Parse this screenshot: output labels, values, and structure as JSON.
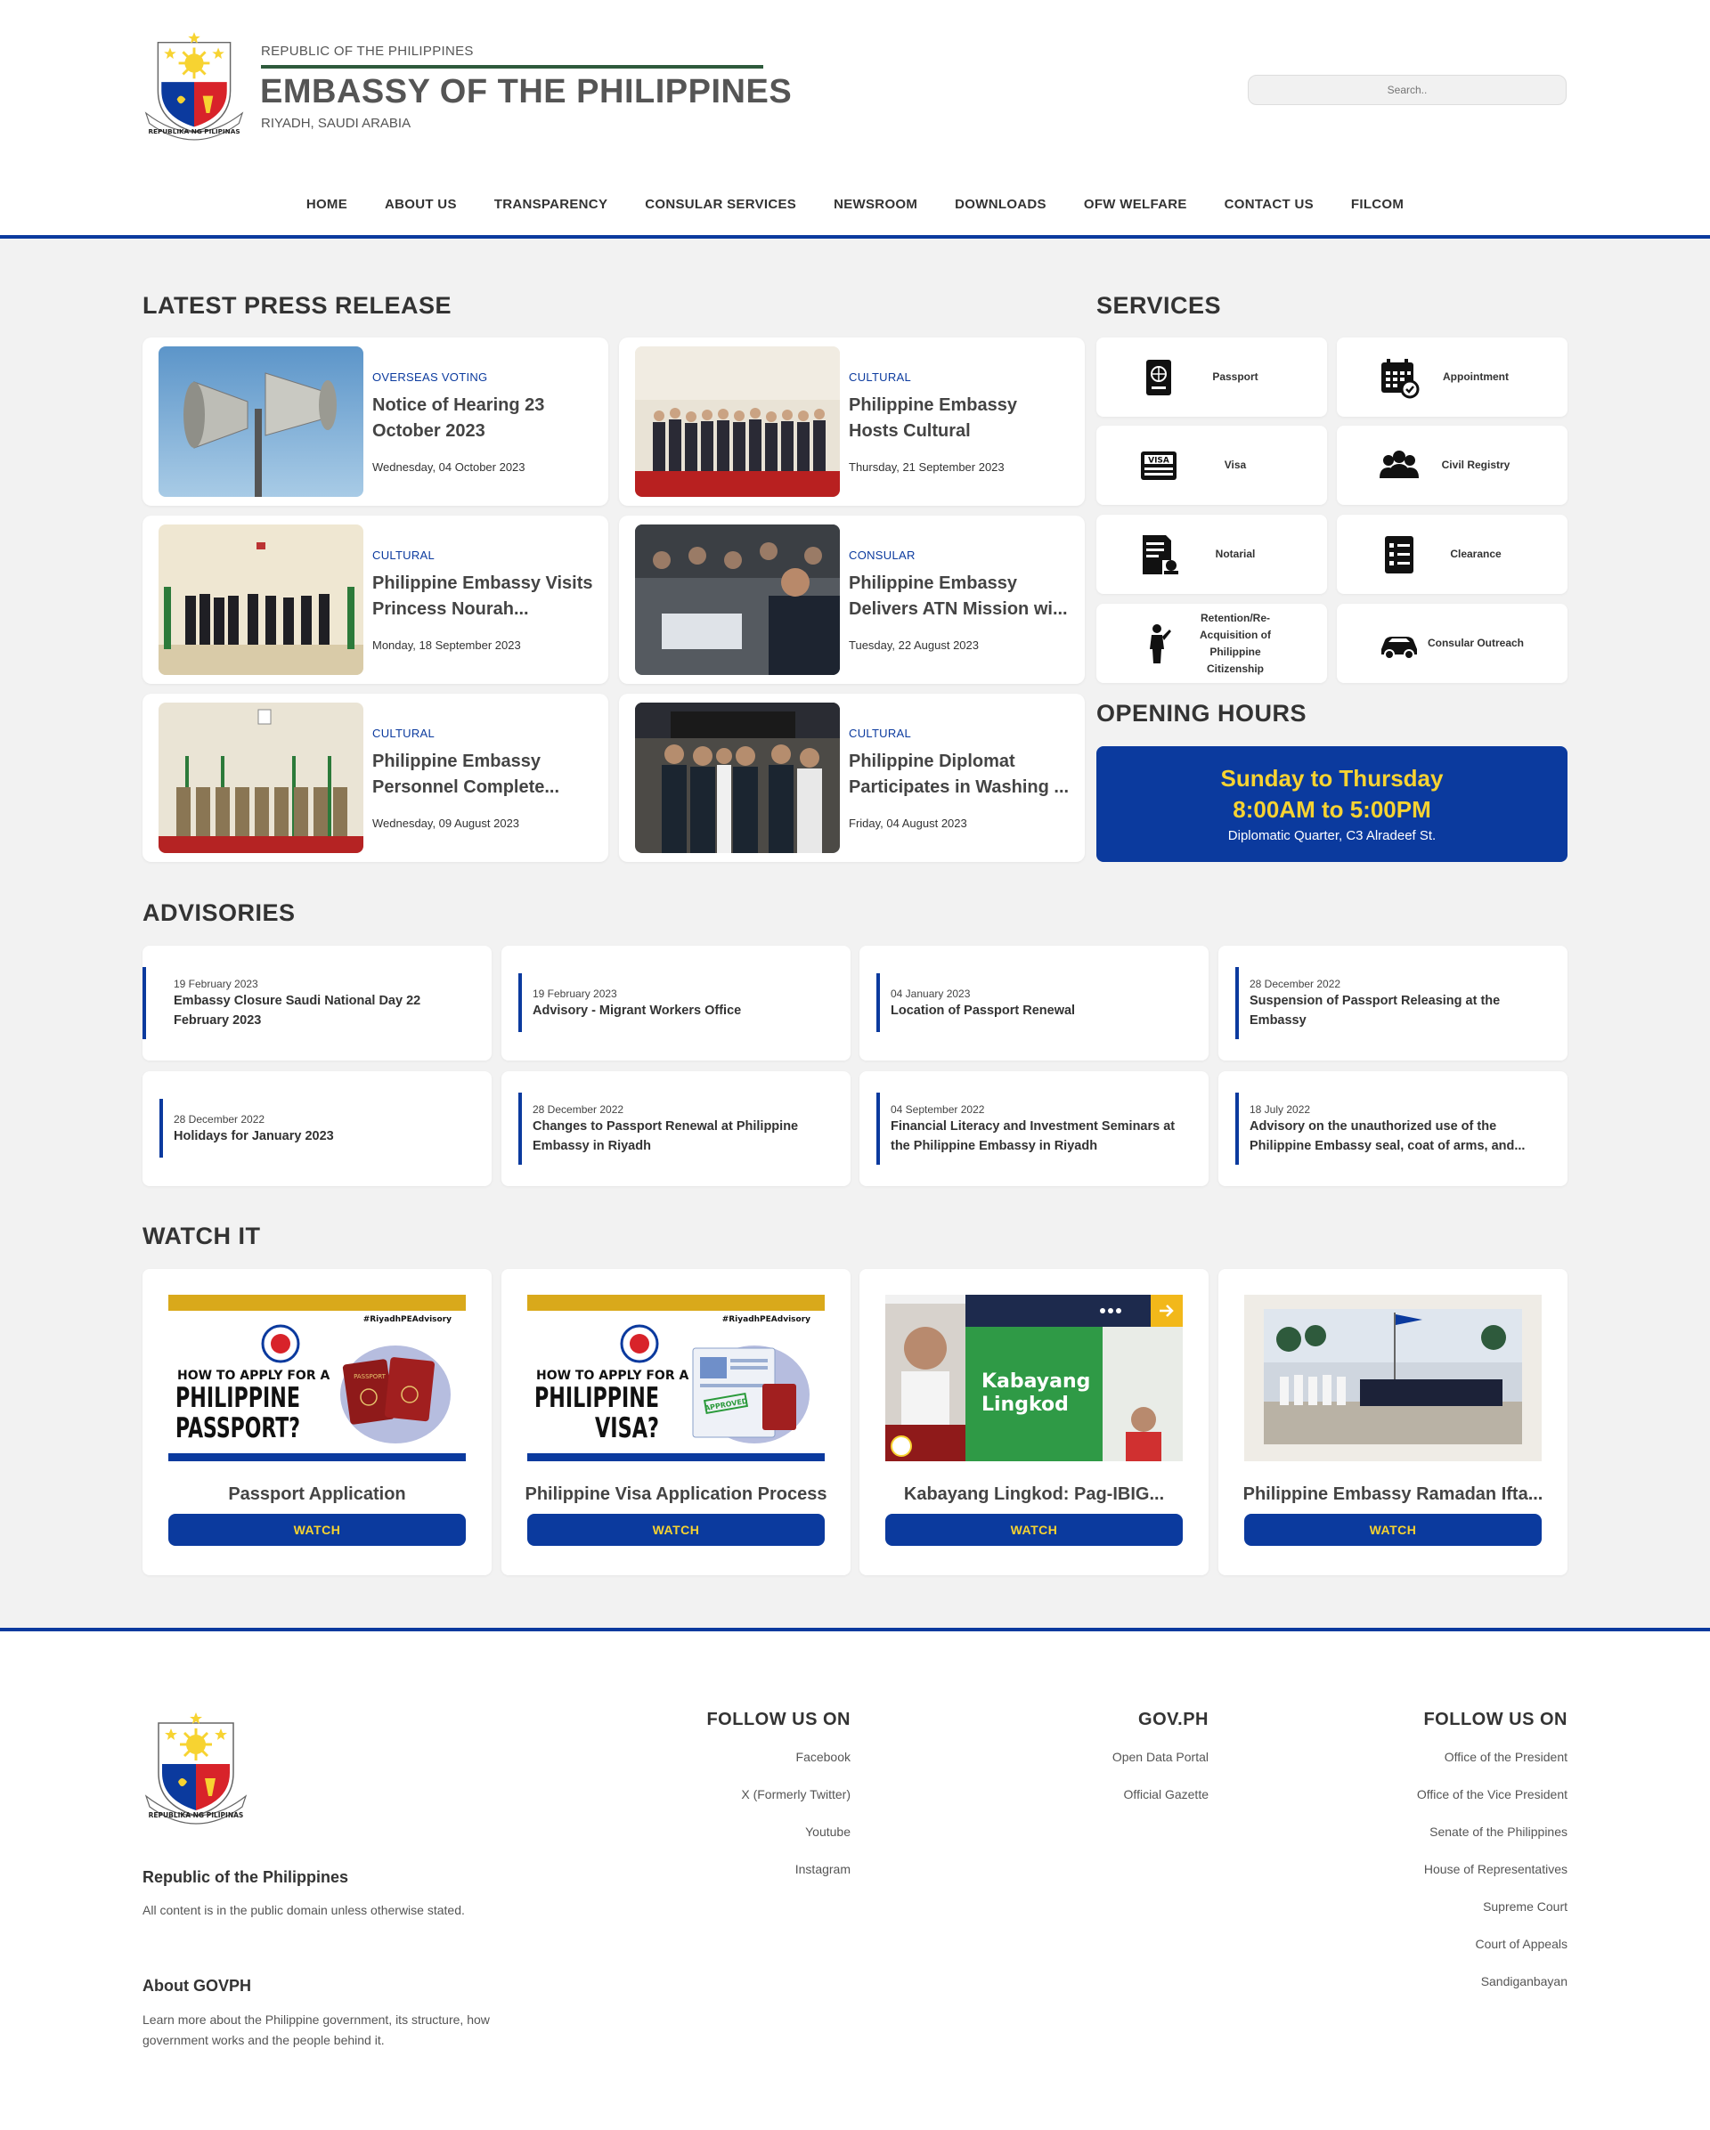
{
  "header": {
    "republic": "REPUBLIC OF THE PHILIPPINES",
    "title": "EMBASSY OF THE PHILIPPINES",
    "location": "RIYADH, SAUDI ARABIA",
    "search_placeholder": "Search..",
    "seal_text": "REPUBLIKA NG PILIPINAS"
  },
  "nav": [
    "HOME",
    "ABOUT US",
    "TRANSPARENCY",
    "CONSULAR SERVICES",
    "NEWSROOM",
    "DOWNLOADS",
    "OFW WELFARE",
    "CONTACT US",
    "FILCOM"
  ],
  "press": {
    "heading": "LATEST PRESS RELEASE",
    "items": [
      {
        "category": "OVERSEAS VOTING",
        "title": "Notice of Hearing 23 October 2023",
        "date": "Wednesday, 04 October 2023"
      },
      {
        "category": "CULTURAL",
        "title": "Philippine Embassy Hosts Cultural Diplomacy...",
        "date": "Thursday, 21 September 2023"
      },
      {
        "category": "CULTURAL",
        "title": "Philippine Embassy Visits Princess Nourah...",
        "date": "Monday, 18 September 2023"
      },
      {
        "category": "CONSULAR",
        "title": "Philippine Embassy Delivers ATN Mission wi...",
        "date": "Tuesday, 22 August 2023"
      },
      {
        "category": "CULTURAL",
        "title": "Philippine Embassy Personnel Complete...",
        "date": "Wednesday, 09 August 2023"
      },
      {
        "category": "CULTURAL",
        "title": "Philippine Diplomat Participates in Washing ...",
        "date": "Friday, 04 August 2023"
      }
    ]
  },
  "services": {
    "heading": "SERVICES",
    "items": [
      {
        "label": "Passport",
        "icon": "passport-icon"
      },
      {
        "label": "Appointment",
        "icon": "calendar-icon"
      },
      {
        "label": "Visa",
        "icon": "visa-icon",
        "badge": "VISA"
      },
      {
        "label": "Civil Registry",
        "icon": "people-icon"
      },
      {
        "label": "Notarial",
        "icon": "notarial-icon"
      },
      {
        "label": "Clearance",
        "icon": "checklist-icon"
      },
      {
        "label": "Retention/Re-Acquisition of Philippine Citizenship",
        "icon": "person-icon"
      },
      {
        "label": "Consular Outreach",
        "icon": "car-icon"
      }
    ]
  },
  "hours": {
    "heading": "OPENING HOURS",
    "days": "Sunday to Thursday",
    "time": "8:00AM to 5:00PM",
    "address": "Diplomatic Quarter, C3 Alradeef St."
  },
  "advisories": {
    "heading": "ADVISORIES",
    "items": [
      {
        "date": "19 February 2023",
        "title": "Embassy Closure Saudi National Day 22 February 2023"
      },
      {
        "date": "19 February 2023",
        "title": "Advisory - Migrant Workers Office"
      },
      {
        "date": "04 January 2023",
        "title": "Location of Passport Renewal"
      },
      {
        "date": "28 December 2022",
        "title": "Suspension of Passport Releasing at the Embassy"
      },
      {
        "date": "28 December 2022",
        "title": "Holidays for January 2023"
      },
      {
        "date": "28 December 2022",
        "title": "Changes to Passport Renewal at Philippine Embassy in Riyadh"
      },
      {
        "date": "04 September 2022",
        "title": "Financial Literacy and Investment Seminars at the Philippine Embassy in Riyadh"
      },
      {
        "date": "18 July 2022",
        "title": "Advisory on the unauthorized use of the Philippine Embassy seal, coat of arms, and..."
      }
    ]
  },
  "watch": {
    "heading": "WATCH IT",
    "button": "WATCH",
    "items": [
      {
        "title": "Passport Application",
        "hashtag": "#RiyadhPEAdvisory",
        "thumb_line1": "HOW TO APPLY FOR A",
        "thumb_line2": "PHILIPPINE",
        "thumb_line3": "PASSPORT?",
        "doc_label": "PASSPORT"
      },
      {
        "title": "Philippine Visa Application Process",
        "hashtag": "#RiyadhPEAdvisory",
        "thumb_line1": "HOW TO APPLY FOR A",
        "thumb_line2": "PHILIPPINE",
        "thumb_line3": "VISA?",
        "doc_label": "APPROVED"
      },
      {
        "title": "Kabayang Lingkod: Pag-IBIG...",
        "thumb_line1": "Kabayang",
        "thumb_line2": "Lingkod"
      },
      {
        "title": "Philippine Embassy Ramadan Ifta..."
      }
    ]
  },
  "footer": {
    "seal_text": "REPUBLIKA NG PILIPINAS",
    "rp_title": "Republic of the Philippines",
    "rp_text": "All content is in the public domain unless otherwise stated.",
    "about_title": "About GOVPH",
    "about_text": "Learn more about the Philippine government, its structure, how government works and the people behind it.",
    "col1": {
      "heading": "FOLLOW US ON",
      "links": [
        "Facebook",
        "X (Formerly Twitter)",
        "Youtube",
        "Instagram"
      ]
    },
    "col2": {
      "heading": "GOV.PH",
      "links": [
        "Open Data Portal",
        "Official Gazette"
      ]
    },
    "col3": {
      "heading": "FOLLOW US ON",
      "links": [
        "Office of the President",
        "Office of the Vice President",
        "Senate of the Philippines",
        "House of Representatives",
        "Supreme Court",
        "Court of Appeals",
        "Sandiganbayan"
      ]
    }
  }
}
